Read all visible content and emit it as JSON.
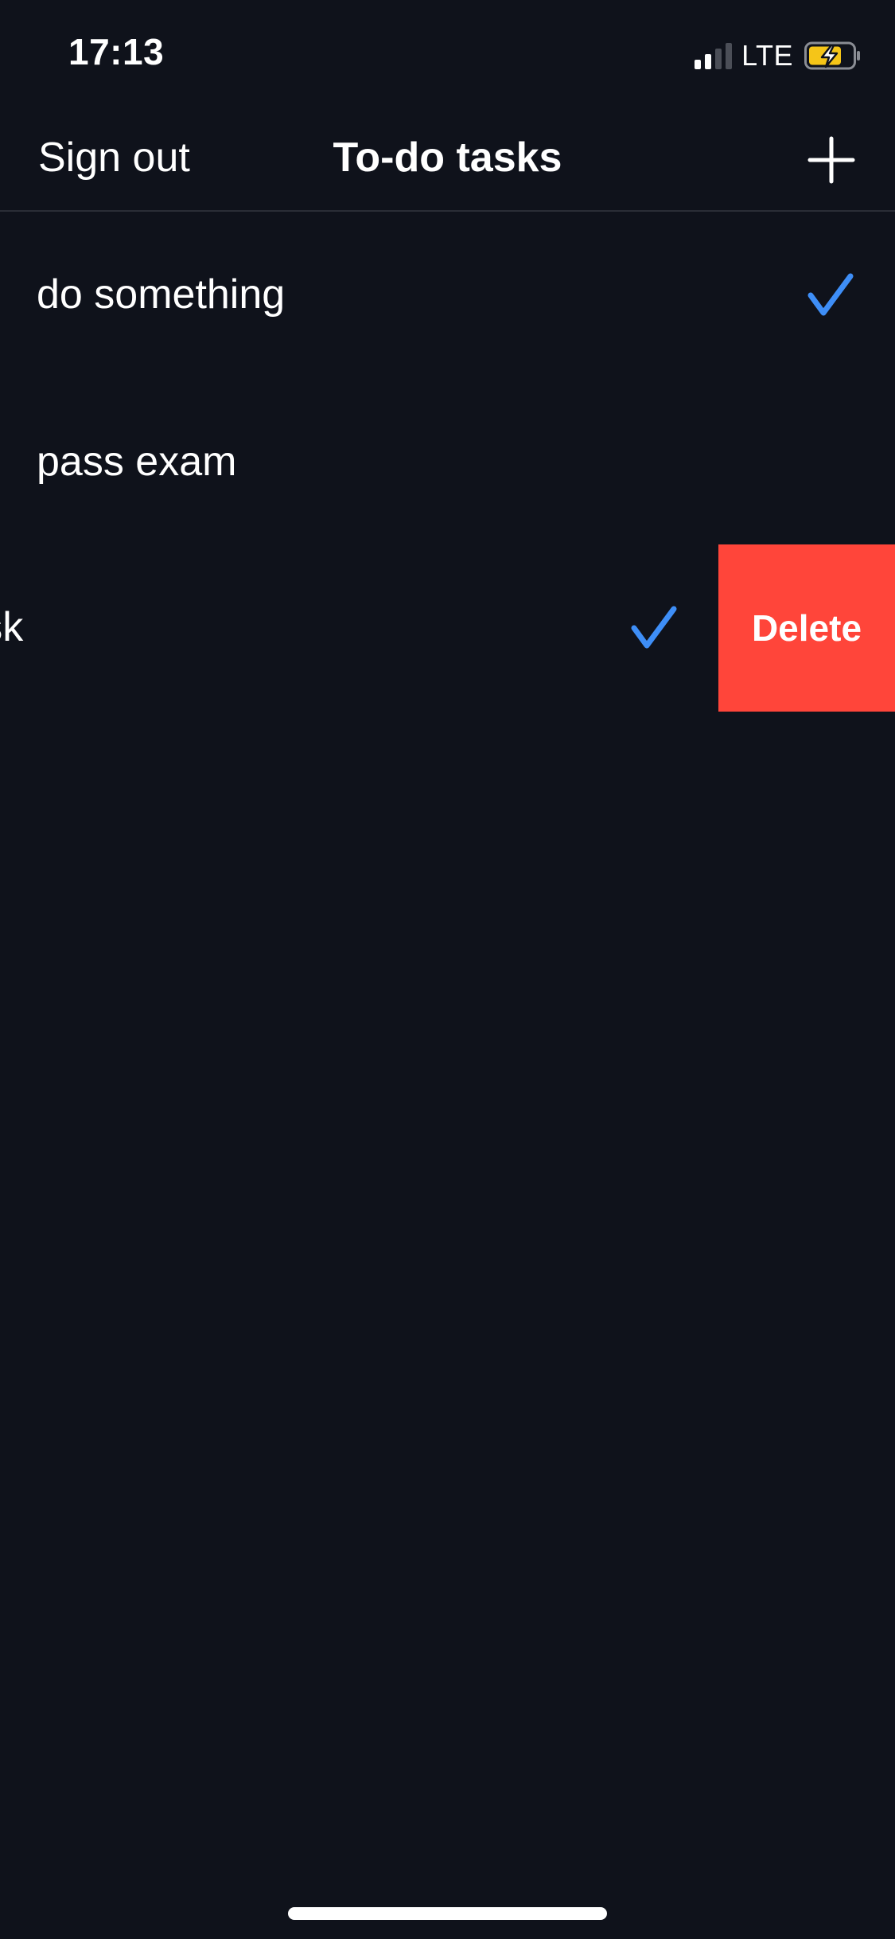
{
  "status_bar": {
    "time": "17:13",
    "network": "LTE",
    "signal_bars_active": 2,
    "signal_bars_total": 4,
    "battery_icon": "battery-charging-icon",
    "battery_color": "#f5c518"
  },
  "nav": {
    "left_button_label": "Sign out",
    "title": "To-do tasks",
    "add_icon": "plus-icon"
  },
  "tasks": [
    {
      "label": "do something",
      "completed": true
    },
    {
      "label": "pass exam",
      "completed": false
    },
    {
      "label": "new task",
      "completed": true,
      "swipe_action": "Delete"
    }
  ],
  "colors": {
    "background": "#0f121b",
    "check": "#3e8ef7",
    "delete": "#ff453a"
  }
}
